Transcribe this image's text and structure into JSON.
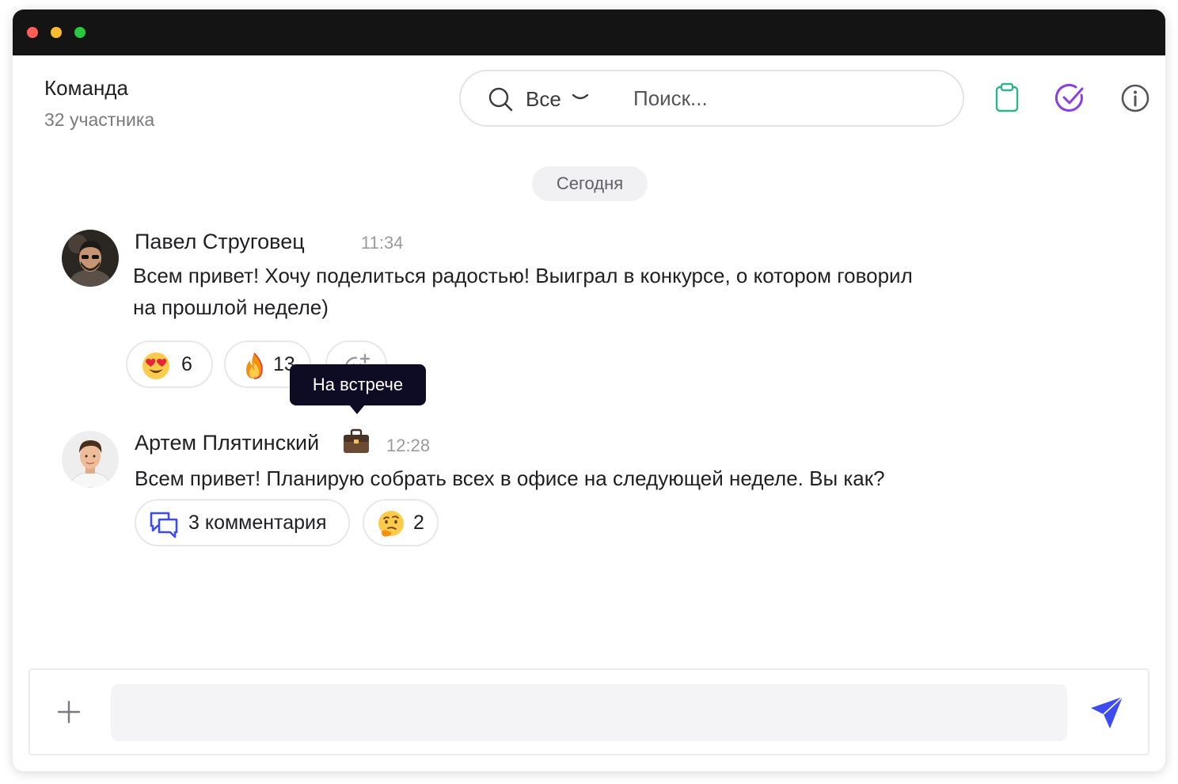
{
  "window": {
    "controls": [
      "close",
      "minimize",
      "maximize"
    ],
    "colors": {
      "close": "#ff5f57",
      "minimize": "#febc2e",
      "maximize": "#28c840",
      "titlebar": "#141414"
    }
  },
  "header": {
    "title": "Команда",
    "subtitle": "32 участника",
    "search": {
      "scope_label": "Все",
      "placeholder": "Поиск..."
    },
    "icons": [
      "clipboard-icon",
      "check-circle-icon",
      "info-icon"
    ],
    "icon_colors": {
      "clipboard": "#2bb58a",
      "check": "#8a3fe0",
      "info": "#55555b"
    }
  },
  "date_separator": "Сегодня",
  "messages": [
    {
      "author": "Павел Струговец",
      "time": "11:34",
      "text_line1": "Всем привет! Хочу поделиться радостью! Выиграл в конкурсе, о котором говорил",
      "text_line2": "на прошлой неделе)",
      "reactions": [
        {
          "emoji": "heart-eyes",
          "count": "6"
        },
        {
          "emoji": "fire",
          "count": "13"
        }
      ],
      "add_reaction_icon": "add-emoji-icon"
    },
    {
      "author": "Артем Плятинский",
      "status_icon": "briefcase-icon",
      "status_tooltip": "На встрече",
      "time": "12:28",
      "text": "Всем привет! Планирую собрать всех в офисе на следующей неделе. Вы как?",
      "comments_label": "3 комментария",
      "reactions": [
        {
          "emoji": "thinking-face",
          "count": "2"
        }
      ]
    }
  ],
  "composer": {
    "input_value": "",
    "accent_color": "#3d4cf0"
  }
}
